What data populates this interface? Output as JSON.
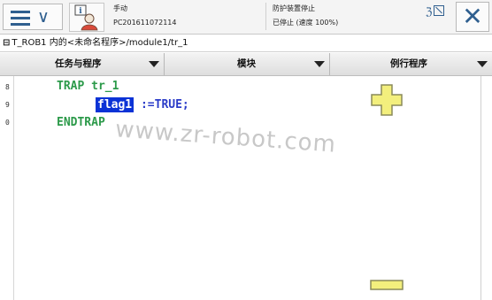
{
  "status": {
    "mode": "手动",
    "controller": "PC201611072114",
    "safety": "防护装置停止",
    "state": "已停止 (速度 100%)"
  },
  "breadcrumb": {
    "icon": "⊟",
    "path": "T_ROB1 内的<未命名程序>/module1/tr_1"
  },
  "menubar": {
    "tasks_label": "任务与程序",
    "modules_label": "模块",
    "routines_label": "例行程序"
  },
  "editor": {
    "line_numbers": [
      "8",
      "9",
      "0"
    ],
    "line1_kw": "TRAP",
    "line1_name": "tr_1",
    "line2_selected": "flag1",
    "line2_rest": ":=TRUE;",
    "line3_kw": "ENDTRAP"
  },
  "watermark": "www.zr-robot.com",
  "colors": {
    "keyword": "#2c9a4a",
    "selection": "#0b33d6",
    "accent": "#2f5f8f",
    "zoom_icon": "#f3ef7d"
  },
  "icons": {
    "menu": "hamburger-icon",
    "status": "info-user-icon",
    "close": "close-icon",
    "zoom_in": "plus-icon",
    "zoom_out": "minus-icon"
  }
}
